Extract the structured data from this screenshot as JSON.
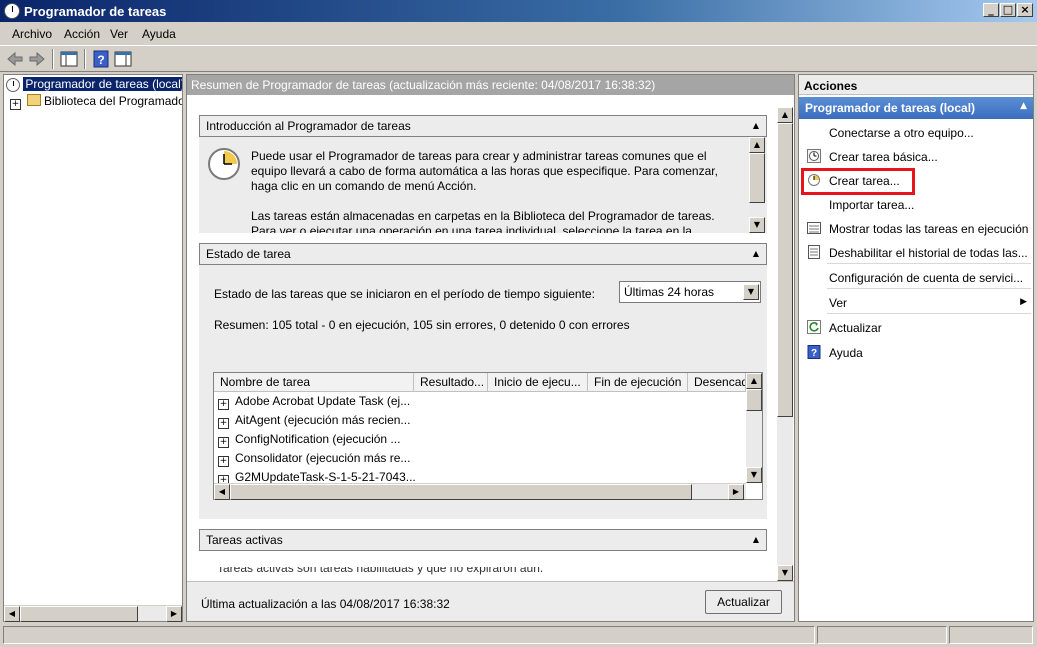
{
  "window": {
    "title": "Programador de tareas"
  },
  "menu": [
    "Archivo",
    "Acción",
    "Ver",
    "Ayuda"
  ],
  "tree": {
    "root": "Programador de tareas (local)",
    "child": "Biblioteca del Programador de tareas"
  },
  "center": {
    "header": "Resumen de Programador de tareas (actualización más reciente: 04/08/2017 16:38:32)",
    "intro": {
      "title": "Introducción al Programador de tareas",
      "p1": "Puede usar el Programador de tareas para crear y administrar tareas comunes que el equipo llevará a cabo de forma automática a las horas que especifique. Para comenzar, haga clic en un comando de menú Acción.",
      "p2": "Las tareas están almacenadas en carpetas en la Biblioteca del Programador de tareas. Para ver o ejecutar una operación en una tarea individual, seleccione la tarea en la Biblioteca del"
    },
    "status": {
      "title": "Estado de tarea",
      "period_label": "Estado de las tareas que se iniciaron en el período de tiempo siguiente:",
      "period_value": "Últimas 24 horas",
      "summary": "Resumen: 105 total - 0 en ejecución, 105 sin errores, 0 detenido  0 con errores",
      "columns": [
        "Nombre de tarea",
        "Resultado...",
        "Inicio de ejecu...",
        "Fin de ejecución",
        "Desencad"
      ],
      "rows": [
        "Adobe Acrobat Update Task (ej...",
        "AitAgent (ejecución más recien...",
        "ConfigNotification (ejecución ...",
        "Consolidator (ejecución más re...",
        "G2MUpdateTask-S-1-5-21-7043..."
      ]
    },
    "active": {
      "title": "Tareas activas",
      "partial_text": "Tareas activas son tareas habilitadas y que no expiraron aún."
    },
    "footer": {
      "last_update": "Última actualización a las 04/08/2017 16:38:32",
      "refresh": "Actualizar"
    }
  },
  "actions": {
    "title": "Acciones",
    "group": "Programador de tareas (local)",
    "items": [
      {
        "label": "Conectarse a otro equipo...",
        "icon": "none"
      },
      {
        "label": "Crear tarea básica...",
        "icon": "basic-task-icon"
      },
      {
        "label": "Crear tarea...",
        "icon": "create-task-icon"
      },
      {
        "label": "Importar tarea...",
        "icon": "none"
      },
      {
        "label": "Mostrar todas las tareas en ejecución",
        "icon": "running-tasks-icon"
      },
      {
        "label": "Deshabilitar el historial de todas las...",
        "icon": "history-icon"
      },
      {
        "label": "Configuración de cuenta de servici...",
        "icon": "none"
      },
      {
        "label": "Ver",
        "icon": "none"
      },
      {
        "label": "Actualizar",
        "icon": "refresh-icon"
      },
      {
        "label": "Ayuda",
        "icon": "help-icon"
      }
    ],
    "highlight_color": "#e8141c"
  }
}
